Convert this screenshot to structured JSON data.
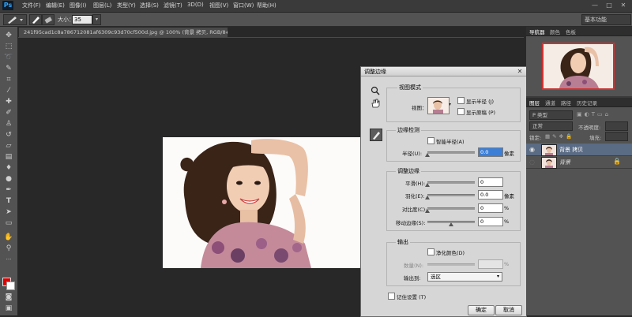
{
  "app": {
    "logo": "Ps"
  },
  "menu": [
    "文件(F)",
    "编辑(E)",
    "图像(I)",
    "图层(L)",
    "类型(Y)",
    "选择(S)",
    "滤镜(T)",
    "3D(D)",
    "视图(V)",
    "窗口(W)",
    "帮助(H)"
  ],
  "window_controls": [
    "—",
    "□",
    "✕"
  ],
  "options": {
    "size_label": "大小：",
    "size_value": "35",
    "workspace": "基本功能"
  },
  "document": {
    "tab_title": "241f95cad1c8a786712081af6309c93d70cf500d.jpg @ 100% (背景 拷贝, RGB/8#) *",
    "tab_close": "×"
  },
  "tools": [
    "move-tool-icon",
    "marquee-icon",
    "lasso-icon",
    "quick-select-icon",
    "crop-icon",
    "eyedropper-icon",
    "healing-icon",
    "brush-icon",
    "clone-stamp-icon",
    "history-brush-icon",
    "eraser-icon",
    "gradient-icon",
    "blur-icon",
    "dodge-icon",
    "pen-icon",
    "type-icon",
    "path-select-icon",
    "shape-icon",
    "hand-icon",
    "zoom-icon"
  ],
  "colors": {
    "foreground": "#e00000",
    "background": "#ffffff",
    "accent": "#30a8ff"
  },
  "dialog": {
    "title": "调整边缘",
    "close": "✕",
    "view_mode": {
      "title": "视图模式",
      "view_label": "视图：",
      "show_radius": "显示半径 (J)",
      "show_original": "显示原稿 (P)"
    },
    "edge_detection": {
      "title": "边缘检测",
      "smart_radius": "智能半径(A)",
      "radius_label": "半径(U):",
      "radius_value": "0.0",
      "radius_unit": "像素",
      "radius_slider": 0.0
    },
    "adjust_edge": {
      "title": "调整边缘",
      "rows": [
        {
          "label": "平滑(H):",
          "value": "0",
          "unit": "",
          "slider": 0.0
        },
        {
          "label": "羽化(E):",
          "value": "0.0",
          "unit": "像素",
          "slider": 0.0
        },
        {
          "label": "对比度(C):",
          "value": "0",
          "unit": "%",
          "slider": 0.0
        },
        {
          "label": "移动边缘(S):",
          "value": "0",
          "unit": "%",
          "slider": 0.5
        }
      ]
    },
    "output": {
      "title": "输出",
      "decontaminate": "净化颜色(D)",
      "amount_label": "数量(N):",
      "amount_unit": "%",
      "output_to_label": "输出到:",
      "output_to_value": "选区"
    },
    "remember": "记住设置 (T)",
    "ok": "确定",
    "cancel": "取消"
  },
  "panels": {
    "nav_tabs": [
      "导航器",
      "颜色",
      "色板"
    ],
    "layer_tabs": [
      "图层",
      "通道",
      "路径",
      "历史记录"
    ],
    "kind_filter": "P 类型",
    "blend_mode": "正常",
    "opacity_label": "不透明度:",
    "lock_label": "锁定:",
    "fill_label": "填充:",
    "layers": [
      {
        "name": "背景 拷贝",
        "selected": true,
        "locked": false
      },
      {
        "name": "背景",
        "selected": false,
        "locked": true
      }
    ]
  }
}
